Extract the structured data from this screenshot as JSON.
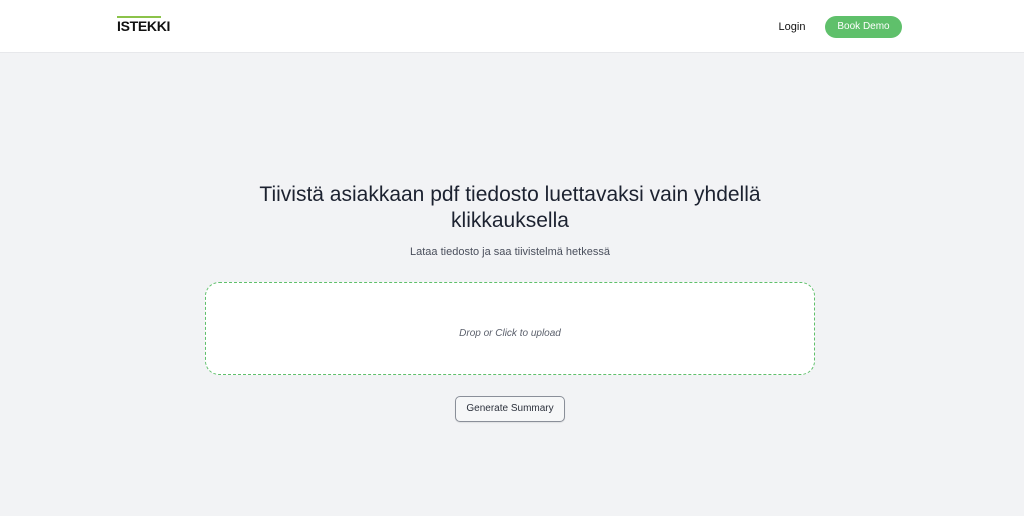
{
  "header": {
    "logo_text": "ISTEKKI",
    "login_label": "Login",
    "book_demo_label": "Book Demo"
  },
  "main": {
    "headline": "Tiivistä asiakkaan pdf tiedosto luettavaksi vain yhdellä klikkauksella",
    "subtitle": "Lataa tiedosto ja saa tiivistelmä hetkessä",
    "dropzone_label": "Drop or Click to upload",
    "generate_label": "Generate Summary"
  },
  "colors": {
    "accent": "#5fc06b",
    "logo_accent": "#8bc34a",
    "background": "#f2f3f5",
    "header_background": "#ffffff"
  }
}
